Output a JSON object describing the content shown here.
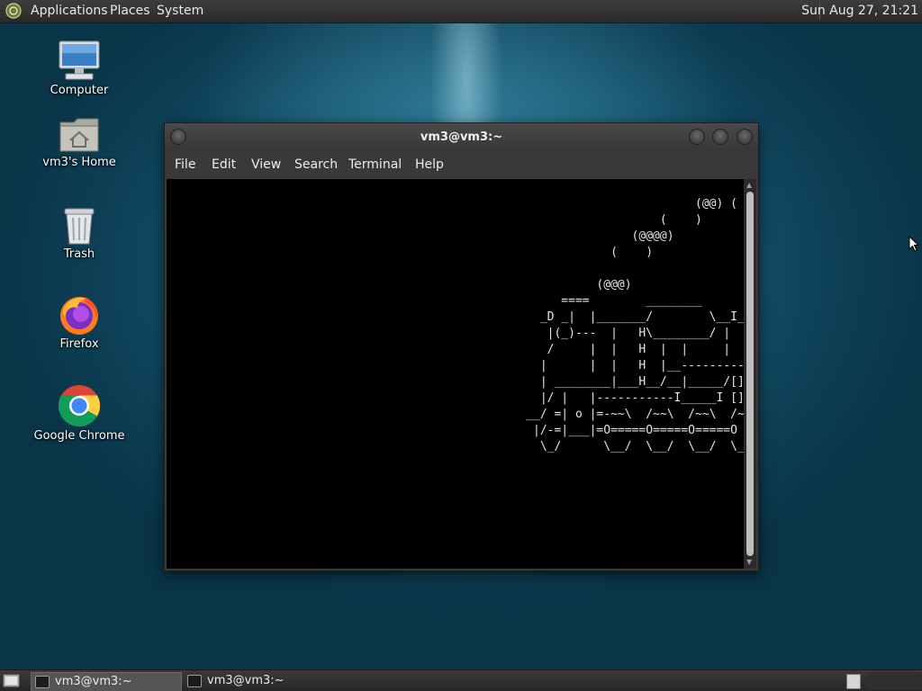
{
  "top_panel": {
    "menus": [
      "Applications",
      "Places",
      "System"
    ],
    "clock": "Sun Aug 27, 21:21"
  },
  "desktop_icons": [
    {
      "label": "Computer",
      "icon": "computer-icon"
    },
    {
      "label": "vm3's Home",
      "icon": "home-folder-icon"
    },
    {
      "label": "Trash",
      "icon": "trash-icon"
    },
    {
      "label": "Firefox",
      "icon": "firefox-icon"
    },
    {
      "label": "Google Chrome",
      "icon": "chrome-icon"
    }
  ],
  "terminal": {
    "title": "vm3@vm3:~",
    "menu": [
      "File",
      "Edit",
      "View",
      "Search",
      "Terminal",
      "Help"
    ],
    "output": "                                                                           (@@) (  ) (@)  ( )\n                                                                      (    )\n                                                                  (@@@@)\n                                                               (    )\n\n                                                             (@@@)\n                                                        ====        ________\n                                                     _D _|  |_______/        \\__I_I_____===__\n                                                      |(_)---  |   H\\________/ |   |        =\n                                                      /     |  |   H  |  |     |   |\n                                                     |      |  |   H  |__--------------------\n                                                     | ________|___H__/__|_____/[][]~\\_______\n                                                     |/ |   |-----------I_____I [][] []  D\n                                                   __/ =| o |=-~~\\  /~~\\  /~~\\  /~~\\ ____Y___\n                                                    |/-=|___|=O=====O=====O=====O   |_____/~\\\n                                                     \\_/      \\__/  \\__/  \\__/  \\__/      \\_/"
  },
  "taskbar": {
    "tasks": [
      "vm3@vm3:~",
      "vm3@vm3:~"
    ]
  },
  "colors": {
    "desktop_bg": "#155a74",
    "panel_bg": "#2e2e2e",
    "terminal_bg": "#000000",
    "terminal_fg": "#e6e6e6"
  }
}
